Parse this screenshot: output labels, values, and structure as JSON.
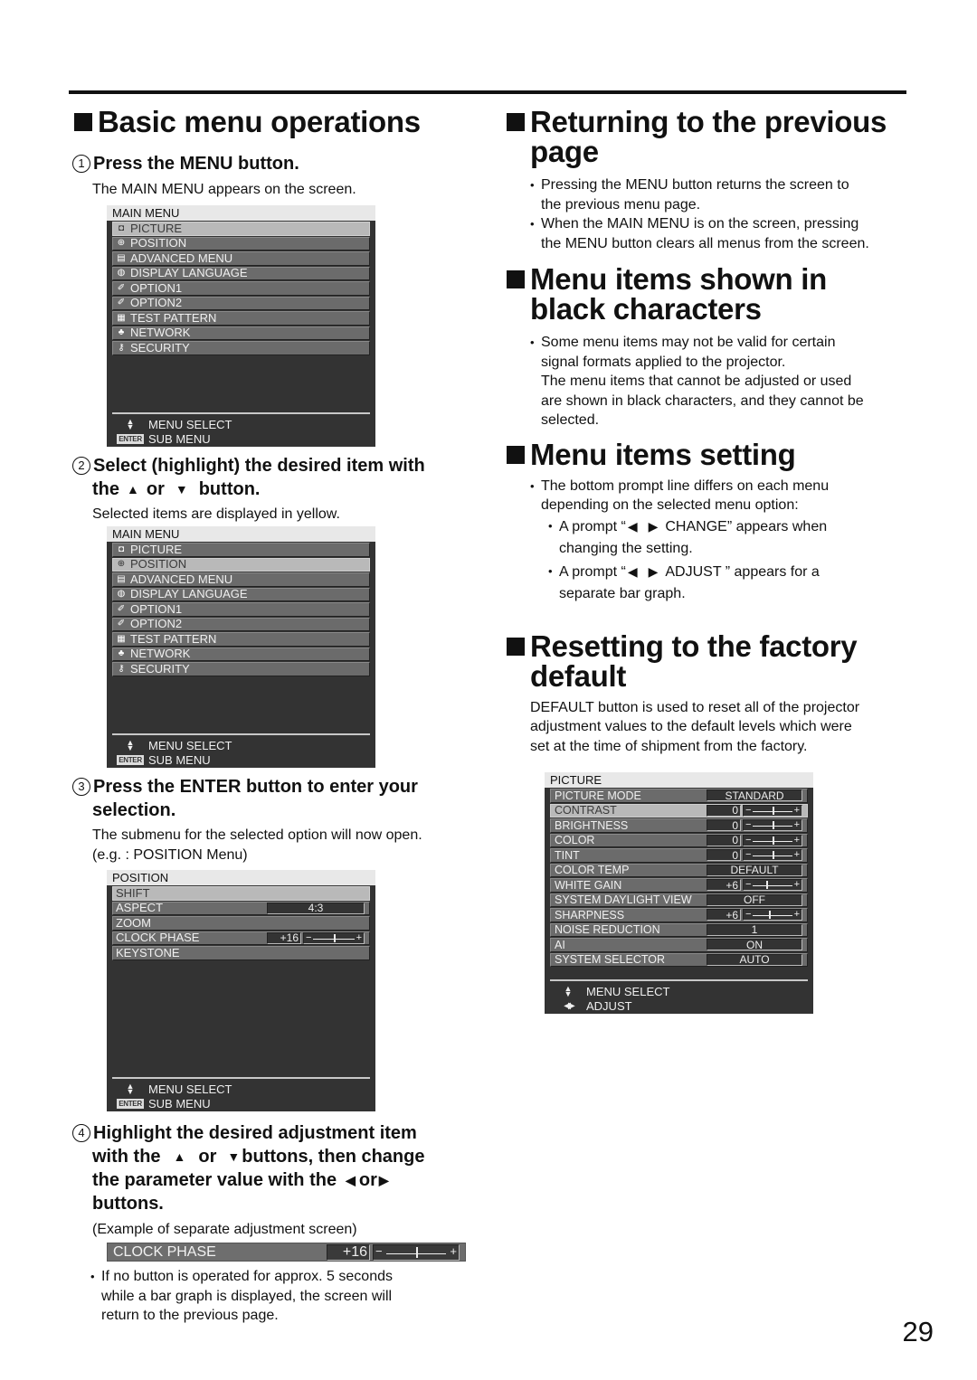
{
  "page_number": "29",
  "left": {
    "section_title": "Basic menu operations",
    "steps": [
      {
        "num": "1",
        "title": "Press the MENU button.",
        "desc": "The MAIN MENU appears on the screen."
      },
      {
        "num": "2",
        "title_a": "Select (highlight) the desired item with",
        "title_b_pre": "the",
        "title_b_mid": "or",
        "title_b_post": "button.",
        "desc": "Selected items are displayed in yellow."
      },
      {
        "num": "3",
        "title_a": "Press the ENTER button to enter your",
        "title_b": "selection.",
        "desc_a": "The submenu for the selected option will now open.",
        "desc_b": "(e.g. : POSITION Menu)"
      },
      {
        "num": "4",
        "line1": "Highlight the desired adjustment item",
        "line2_pre": "with the",
        "line2_mid": "or",
        "line2_post": "buttons, then change",
        "line3_pre": "the parameter value with the",
        "line3_mid": "or",
        "line4": "buttons.",
        "example": "(Example of separate adjustment screen)",
        "note_a": "If no button is operated for approx. 5 seconds",
        "note_b": "while a bar graph is displayed, the screen will",
        "note_c": "return to the previous page."
      }
    ],
    "main_menu": {
      "title": "MAIN MENU",
      "items": [
        {
          "label": "PICTURE",
          "icon": "picture-icon",
          "glyph": "◘"
        },
        {
          "label": "POSITION",
          "icon": "position-icon",
          "glyph": "⊕"
        },
        {
          "label": "ADVANCED MENU",
          "icon": "advanced-menu-icon",
          "glyph": "▤"
        },
        {
          "label": "DISPLAY LANGUAGE",
          "icon": "globe-icon",
          "glyph": "◍"
        },
        {
          "label": "OPTION1",
          "icon": "option-icon",
          "glyph": "✐"
        },
        {
          "label": "OPTION2",
          "icon": "option-icon",
          "glyph": "✐"
        },
        {
          "label": "TEST PATTERN",
          "icon": "test-pattern-icon",
          "glyph": "▦"
        },
        {
          "label": "NETWORK",
          "icon": "network-icon",
          "glyph": "♣"
        },
        {
          "label": "SECURITY",
          "icon": "key-icon",
          "glyph": "⚷"
        }
      ],
      "footer_select": "MENU SELECT",
      "footer_sub": "SUB MENU",
      "enter_badge": "ENTER"
    },
    "position_menu": {
      "title": "POSITION",
      "items": [
        {
          "label": "SHIFT"
        },
        {
          "label": "ASPECT",
          "value": "4:3"
        },
        {
          "label": "ZOOM"
        },
        {
          "label": "CLOCK PHASE",
          "value": "+16",
          "bar": 0.5
        },
        {
          "label": "KEYSTONE"
        }
      ]
    },
    "clock_phase_bar": {
      "label": "CLOCK PHASE",
      "value": "+16",
      "level": 0.5,
      "minus": "−",
      "plus": "+"
    }
  },
  "right": {
    "returning": {
      "title_a": "Returning to the previous",
      "title_b": "page",
      "bullets": [
        [
          "Pressing the MENU button returns the screen to",
          "the previous menu page."
        ],
        [
          "When the MAIN MENU is on the screen, pressing",
          "the MENU button clears all menus from the screen."
        ]
      ]
    },
    "black_chars": {
      "title_a": "Menu items shown in",
      "title_b": "black characters",
      "lines": [
        "Some menu items may not be valid for certain",
        "signal formats applied to the projector.",
        "The menu items that cannot be adjusted or used",
        "are shown in black characters, and they cannot be",
        "selected."
      ]
    },
    "setting": {
      "title": "Menu items setting",
      "lines": [
        "The bottom prompt line differs on each menu",
        "depending on the selected menu option:"
      ],
      "prompt1_pre": "A prompt “",
      "prompt1_post": "CHANGE” appears when",
      "prompt1_b": "changing the setting.",
      "prompt2_pre": "A prompt “",
      "prompt2_post": "ADJUST  ” appears for a",
      "prompt2_b": "separate bar graph."
    },
    "reset": {
      "title_a": "Resetting to the factory",
      "title_b": "default",
      "lines": [
        "DEFAULT button is used to reset all of the projector",
        "adjustment values to the default levels which were",
        "set at the time of shipment from the factory."
      ]
    },
    "picture_menu": {
      "title": "PICTURE",
      "items": [
        {
          "label": "PICTURE MODE",
          "value": "STANDARD"
        },
        {
          "label": "CONTRAST",
          "value": "0",
          "bar": 0.5
        },
        {
          "label": "BRIGHTNESS",
          "value": "0",
          "bar": 0.5
        },
        {
          "label": "COLOR",
          "value": "0",
          "bar": 0.5
        },
        {
          "label": "TINT",
          "value": "0",
          "bar": 0.5
        },
        {
          "label": "COLOR TEMP",
          "value": "DEFAULT"
        },
        {
          "label": "WHITE GAIN",
          "value": "+6",
          "bar": 0.35
        },
        {
          "label": "SYSTEM DAYLIGHT VIEW",
          "value": "OFF"
        },
        {
          "label": "SHARPNESS",
          "value": "+6",
          "bar": 0.4
        },
        {
          "label": "NOISE REDUCTION",
          "value": "1"
        },
        {
          "label": "AI",
          "value": "ON"
        },
        {
          "label": "SYSTEM SELECTOR",
          "value": "AUTO"
        }
      ],
      "footer_select": "MENU SELECT",
      "footer_adjust": "ADJUST"
    }
  }
}
